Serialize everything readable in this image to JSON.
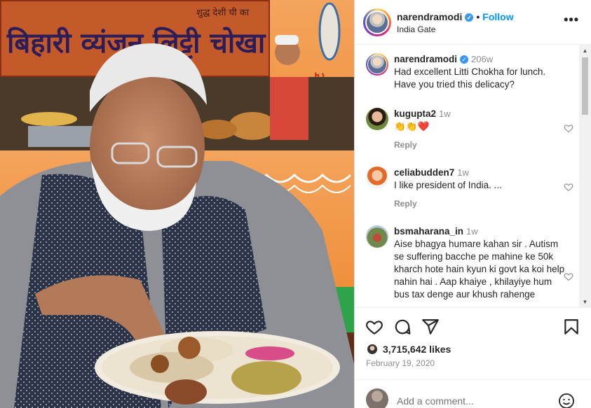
{
  "photo": {
    "banner_text": "बिहारी व्यंजन लिट्टी चोखा",
    "banner_small": "शुद्ध देशी घी का",
    "side_text": "हाट"
  },
  "post_header": {
    "username": "narendramodi",
    "follow_label": "Follow",
    "location": "India Gate",
    "separator": "•",
    "more_label": "•••"
  },
  "comments": [
    {
      "username": "narendramodi",
      "time": "206w",
      "text": "Had excellent Litti Chokha for lunch. Have you tried this delicacy?",
      "verified": true,
      "reply_label": ""
    },
    {
      "username": "kugupta2",
      "time": "1w",
      "text": "👏👏❤️",
      "reply_label": "Reply"
    },
    {
      "username": "celiabudden7",
      "time": "1w",
      "text": "I like president of India. ...",
      "reply_label": "Reply"
    },
    {
      "username": "bsmaharana_in",
      "time": "1w",
      "text": "Aise bhagya humare kahan sir . Autism se suffering bacche pe mahine ke 50k kharch hote hain kyun ki govt ka koi help nahin hai . Aap khaiye , khilayiye hum bus tax denge aur khush rahenge",
      "reply_label": ""
    }
  ],
  "scrollbar": {
    "up": "▲",
    "down": "▼"
  },
  "actions": {
    "likes_count": "3,715,642 likes",
    "date": "February 19, 2020",
    "add_comment_placeholder": "Add a comment..."
  },
  "colors": {
    "accent": "#0095f6",
    "verified": "#3897f0",
    "muted": "#8e8e8e",
    "heart": "#ed4956"
  },
  "icons": [
    "heart-icon",
    "comment-icon",
    "share-icon",
    "bookmark-icon",
    "emoji-icon",
    "more-icon",
    "verified-icon"
  ]
}
